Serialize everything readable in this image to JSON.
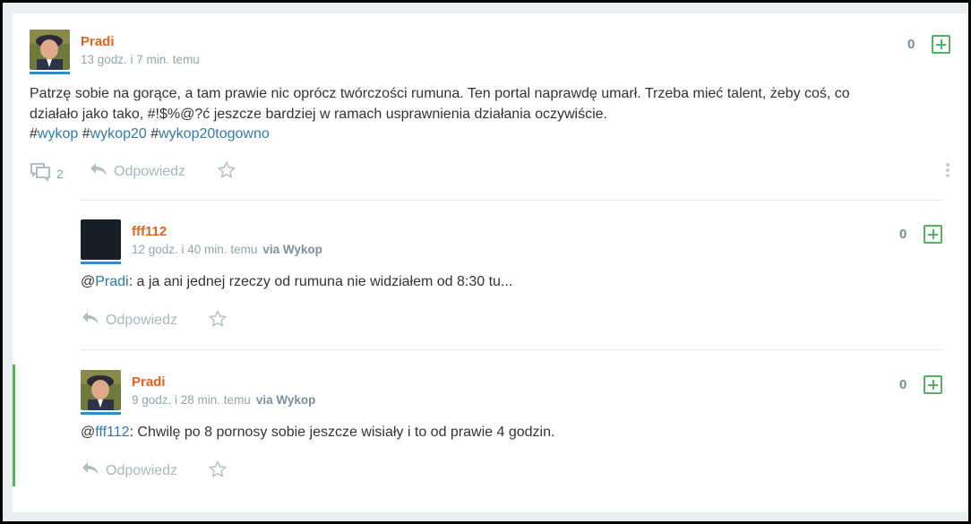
{
  "post": {
    "author": "Pradi",
    "time": "13 godz. i 7 min. temu",
    "score": "0",
    "text_line1": "Patrzę sobie na gorące, a tam prawie nic oprócz twórczości rumuna. Ten portal naprawdę umarł. Trzeba mieć talent, żeby coś, co",
    "text_line2": "działało jako tako, #!$%@?ć jeszcze bardziej w ramach usprawnienia działania oczywiście.",
    "tags": [
      "wykop",
      "wykop20",
      "wykop20togowno"
    ],
    "comment_count": "2",
    "reply_label": "Odpowiedz"
  },
  "comments": [
    {
      "author": "fff112",
      "time": "12 godz. i 40 min. temu",
      "via": "via Wykop",
      "score": "0",
      "mention": "Pradi",
      "text": ": a ja ani jednej rzeczy od rumuna nie widziałem od 8:30 tu...",
      "reply_label": "Odpowiedz"
    },
    {
      "author": "Pradi",
      "time": "9 godz. i 28 min. temu",
      "via": "via Wykop",
      "score": "0",
      "mention": "fff112",
      "text": ": Chwilę po 8 pornosy sobie jeszcze wisiały i to od prawie 4 godzin.",
      "reply_label": "Odpowiedz"
    }
  ],
  "colors": {
    "username": "#e8611c",
    "link": "#2f7aa8",
    "plus": "#4fb35f",
    "accent_bar": "#2d8ec9"
  }
}
